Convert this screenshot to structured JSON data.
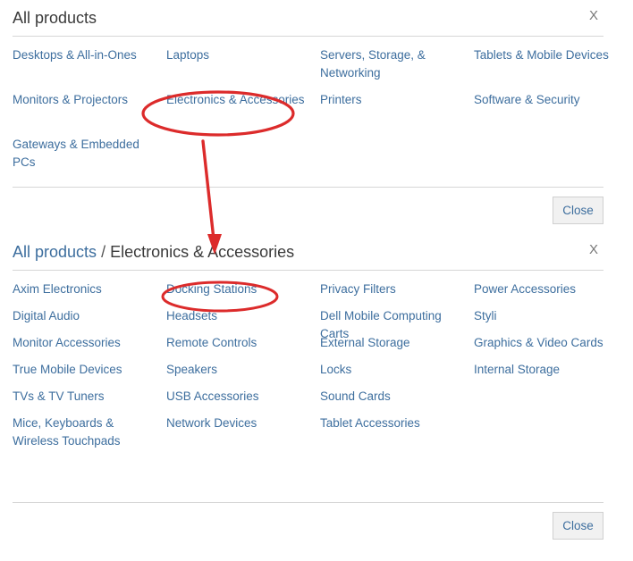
{
  "accent_link_color": "#3d6e9e",
  "annotation_color": "#d32a २",
  "panels": [
    {
      "id": "all-products",
      "title": "All products",
      "close_icon": "X",
      "close_button_label": "Close",
      "links": [
        "Desktops & All-in-Ones",
        "Laptops",
        "Servers, Storage, & Networking",
        "Tablets & Mobile Devices",
        "Monitors & Projectors",
        "Electronics & Accessories",
        "Printers",
        "Software & Security",
        "Gateways & Embedded PCs"
      ]
    },
    {
      "id": "electronics-accessories",
      "breadcrumb_root": "All products",
      "breadcrumb_separator": "/",
      "breadcrumb_current": "Electronics & Accessories",
      "close_icon": "X",
      "close_button_label": "Close",
      "links": [
        "Axim Electronics",
        "Docking Stations",
        "Privacy Filters",
        "Power Accessories",
        "Digital Audio",
        "Headsets",
        "Dell Mobile Computing Carts",
        "Styli",
        "Monitor Accessories",
        "Remote Controls",
        "External Storage",
        "Graphics & Video Cards",
        "True Mobile Devices",
        "Speakers",
        "Locks",
        "Internal Storage",
        "TVs & TV Tuners",
        "USB Accessories",
        "Sound Cards",
        "Mice, Keyboards & Wireless Touchpads",
        "Network Devices",
        "Tablet Accessories"
      ]
    }
  ],
  "annotations": {
    "color": "#dc2b2b",
    "ellipse_electronics_label": "Electronics & Accessories",
    "ellipse_docking_label": "Docking Stations",
    "arrow_from": "Electronics & Accessories",
    "arrow_to": "Electronics & Accessories breadcrumb"
  }
}
